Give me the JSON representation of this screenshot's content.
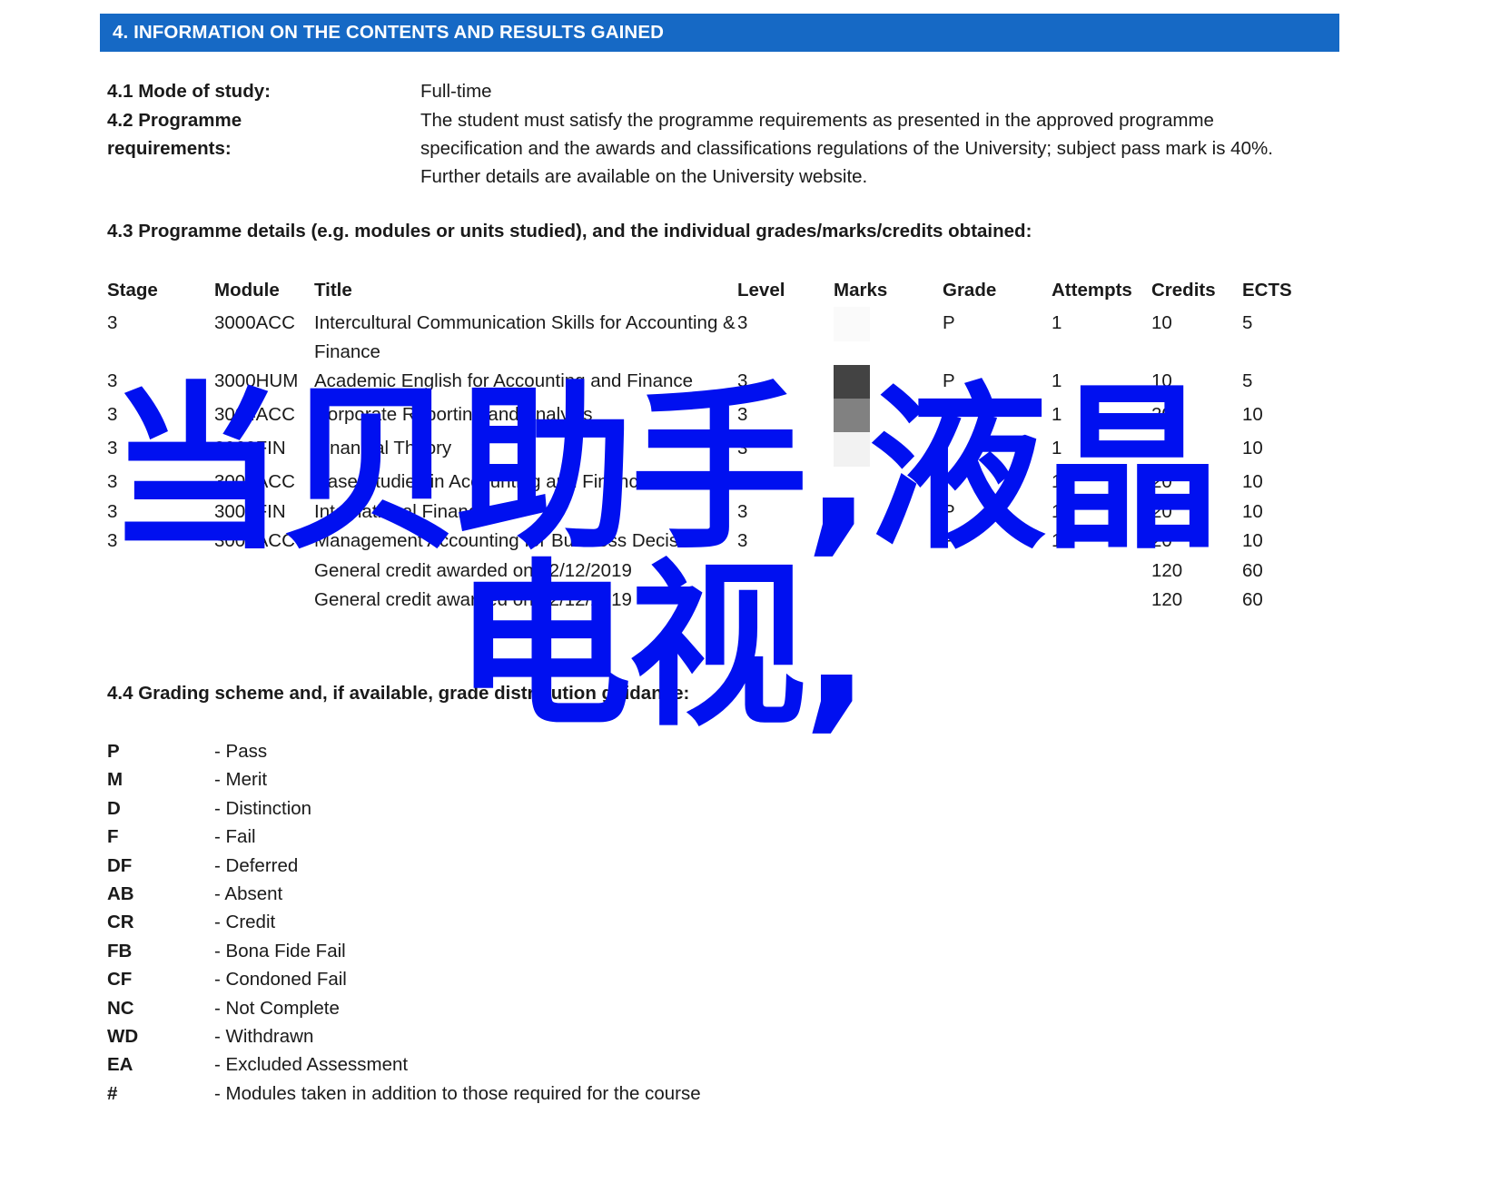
{
  "header": {
    "title": "4. INFORMATION ON THE CONTENTS AND RESULTS GAINED",
    "background_color": "#1669c5",
    "text_color": "#ffffff"
  },
  "meta": {
    "mode_of_study": {
      "label": "4.1 Mode of study:",
      "value": "Full-time"
    },
    "programme_requirements": {
      "label_line1": "4.2 Programme",
      "label_line2": "requirements:",
      "value": "The student must satisfy the programme requirements as presented in the approved programme specification and the awards and classifications regulations of the University; subject pass mark is 40%. Further details are available on the University website."
    }
  },
  "section_43": {
    "heading": "4.3 Programme details (e.g. modules or units studied), and the individual grades/marks/credits obtained:"
  },
  "table": {
    "columns": [
      "Stage",
      "Module",
      "Title",
      "Level",
      "Marks",
      "Grade",
      "Attempts",
      "Credits",
      "ECTS"
    ],
    "rows": [
      {
        "stage": "3",
        "module": "3000ACC",
        "title": "Intercultural Communication Skills for Accounting & Finance",
        "level": "3",
        "marks": "",
        "marks_redaction": "#fafafa",
        "grade": "P",
        "attempts": "1",
        "credits": "10",
        "ects": "5"
      },
      {
        "stage": "3",
        "module": "3000HUM",
        "title": "Academic English for Accounting and Finance",
        "level": "3",
        "marks": "",
        "marks_redaction": "#434343",
        "grade": "P",
        "attempts": "1",
        "credits": "10",
        "ects": "5"
      },
      {
        "stage": "3",
        "module": "3004ACC",
        "title": "Corporate Reporting and Analysis",
        "level": "3",
        "marks": "",
        "marks_redaction": "#818181",
        "grade": "",
        "attempts": "1",
        "credits": "20",
        "ects": "10"
      },
      {
        "stage": "3",
        "module": "3062FIN",
        "title": "Financial Theory",
        "level": "3",
        "marks": "",
        "marks_redaction": "#f2f2f2",
        "grade": "",
        "attempts": "1",
        "credits": "20",
        "ects": "10"
      },
      {
        "stage": "3",
        "module": "3003ACC",
        "title": "Case Studies in Accounting and Finance",
        "level": "3",
        "marks": "",
        "marks_redaction": "#ffffff",
        "grade": "",
        "attempts": "1",
        "credits": "20",
        "ects": "10"
      },
      {
        "stage": "3",
        "module": "3001FIN",
        "title": "International Finance",
        "level": "3",
        "marks": "",
        "marks_redaction": "#ffffff",
        "grade": "P",
        "attempts": "1",
        "credits": "20",
        "ects": "10"
      },
      {
        "stage": "3",
        "module": "3002ACC",
        "title": "Management Accounting for Business Decisions",
        "level": "3",
        "marks": "",
        "marks_redaction": "#ffffff",
        "grade": "P",
        "attempts": "1",
        "credits": "20",
        "ects": "10"
      },
      {
        "stage": "",
        "module": "",
        "title": "General credit awarded on 02/12/2019",
        "level": "",
        "marks": "",
        "marks_redaction": "",
        "grade": "",
        "attempts": "",
        "credits": "120",
        "ects": "60"
      },
      {
        "stage": "",
        "module": "",
        "title": "General credit awarded on 02/12/2019",
        "level": "",
        "marks": "",
        "marks_redaction": "",
        "grade": "",
        "attempts": "",
        "credits": "120",
        "ects": "60"
      }
    ]
  },
  "section_44": {
    "heading": "4.4 Grading scheme and, if available, grade distribution guidance:",
    "legend": [
      {
        "code": "P",
        "desc": "- Pass"
      },
      {
        "code": "M",
        "desc": "- Merit"
      },
      {
        "code": "D",
        "desc": "- Distinction"
      },
      {
        "code": "F",
        "desc": "- Fail"
      },
      {
        "code": "DF",
        "desc": "- Deferred"
      },
      {
        "code": "AB",
        "desc": "- Absent"
      },
      {
        "code": "CR",
        "desc": "- Credit"
      },
      {
        "code": "FB",
        "desc": "- Bona Fide Fail"
      },
      {
        "code": "CF",
        "desc": "- Condoned Fail"
      },
      {
        "code": "NC",
        "desc": "- Not Complete"
      },
      {
        "code": "WD",
        "desc": "- Withdrawn"
      },
      {
        "code": "EA",
        "desc": "- Excluded Assessment"
      },
      {
        "code": "#",
        "desc": "- Modules taken in addition to those required for the course"
      }
    ]
  },
  "watermark": {
    "line1": "当贝助手,液晶",
    "line2": "电视,",
    "color": "#0010f0"
  }
}
